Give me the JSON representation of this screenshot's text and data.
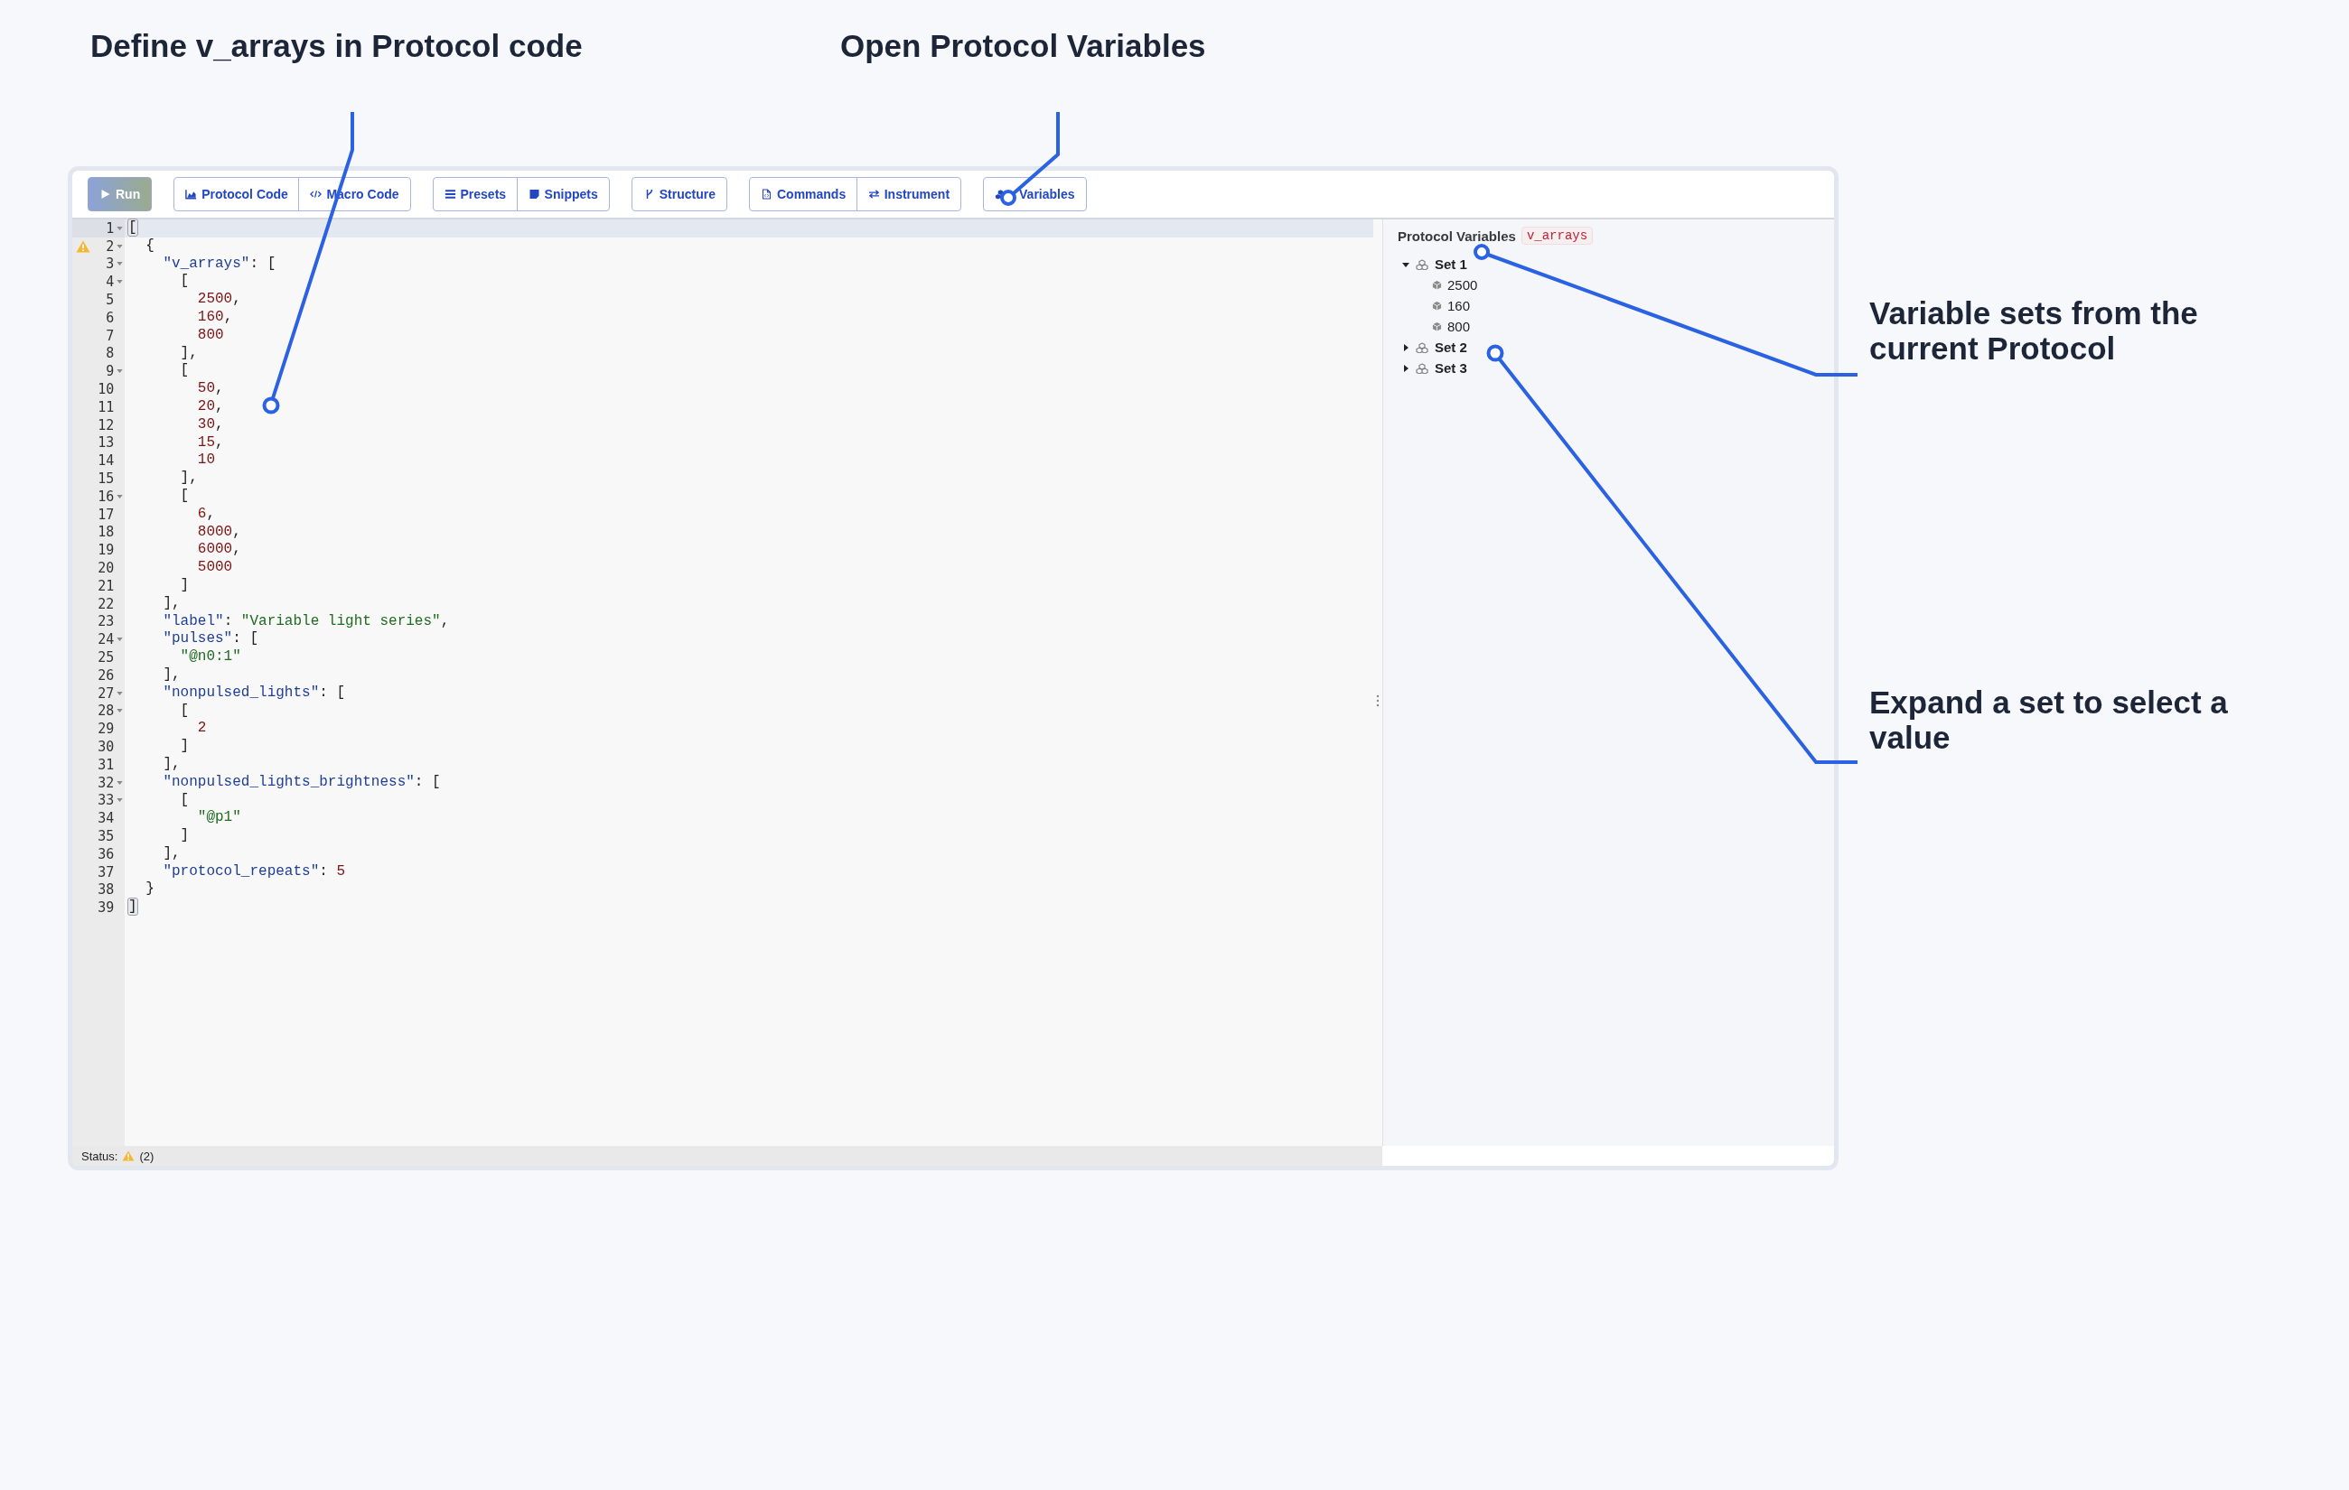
{
  "annotations": [
    {
      "text": "Define v_arrays in Protocol code"
    },
    {
      "text": "Open Protocol Variables"
    },
    {
      "text": "Variable sets from the current Protocol"
    },
    {
      "text": "Expand a set to select a value"
    }
  ],
  "toolbar": {
    "groups": [
      [
        {
          "label": "Run"
        }
      ],
      [
        {
          "label": "Protocol Code"
        },
        {
          "label": "Macro Code"
        }
      ],
      [
        {
          "label": "Presets"
        },
        {
          "label": "Snippets"
        }
      ],
      [
        {
          "label": "Structure"
        }
      ],
      [
        {
          "label": "Commands"
        },
        {
          "label": "Instrument"
        }
      ],
      [
        {
          "label": "Variables"
        }
      ]
    ]
  },
  "editor": {
    "lines": [
      {
        "number": "1",
        "fold": true,
        "warning": false,
        "active": true,
        "tokens": [
          {
            "kind": "bracket",
            "text": "["
          }
        ]
      },
      {
        "number": "2",
        "fold": true,
        "warning": true,
        "active": false,
        "tokens": [
          {
            "kind": "punct",
            "text": "  {"
          }
        ]
      },
      {
        "number": "3",
        "fold": true,
        "warning": false,
        "active": false,
        "tokens": [
          {
            "kind": "key",
            "text": "    \"v_arrays\""
          },
          {
            "kind": "punct",
            "text": ": ["
          }
        ]
      },
      {
        "number": "4",
        "fold": true,
        "warning": false,
        "active": false,
        "tokens": [
          {
            "kind": "punct",
            "text": "      ["
          }
        ]
      },
      {
        "number": "5",
        "fold": false,
        "warning": false,
        "active": false,
        "tokens": [
          {
            "kind": "number",
            "text": "        2500"
          },
          {
            "kind": "punct",
            "text": ","
          }
        ]
      },
      {
        "number": "6",
        "fold": false,
        "warning": false,
        "active": false,
        "tokens": [
          {
            "kind": "number",
            "text": "        160"
          },
          {
            "kind": "punct",
            "text": ","
          }
        ]
      },
      {
        "number": "7",
        "fold": false,
        "warning": false,
        "active": false,
        "tokens": [
          {
            "kind": "number",
            "text": "        800"
          }
        ]
      },
      {
        "number": "8",
        "fold": false,
        "warning": false,
        "active": false,
        "tokens": [
          {
            "kind": "punct",
            "text": "      ],"
          }
        ]
      },
      {
        "number": "9",
        "fold": true,
        "warning": false,
        "active": false,
        "tokens": [
          {
            "kind": "punct",
            "text": "      ["
          }
        ]
      },
      {
        "number": "10",
        "fold": false,
        "warning": false,
        "active": false,
        "tokens": [
          {
            "kind": "number",
            "text": "        50"
          },
          {
            "kind": "punct",
            "text": ","
          }
        ]
      },
      {
        "number": "11",
        "fold": false,
        "warning": false,
        "active": false,
        "tokens": [
          {
            "kind": "number",
            "text": "        20"
          },
          {
            "kind": "punct",
            "text": ","
          }
        ]
      },
      {
        "number": "12",
        "fold": false,
        "warning": false,
        "active": false,
        "tokens": [
          {
            "kind": "number",
            "text": "        30"
          },
          {
            "kind": "punct",
            "text": ","
          }
        ]
      },
      {
        "number": "13",
        "fold": false,
        "warning": false,
        "active": false,
        "tokens": [
          {
            "kind": "number",
            "text": "        15"
          },
          {
            "kind": "punct",
            "text": ","
          }
        ]
      },
      {
        "number": "14",
        "fold": false,
        "warning": false,
        "active": false,
        "tokens": [
          {
            "kind": "number",
            "text": "        10"
          }
        ]
      },
      {
        "number": "15",
        "fold": false,
        "warning": false,
        "active": false,
        "tokens": [
          {
            "kind": "punct",
            "text": "      ],"
          }
        ]
      },
      {
        "number": "16",
        "fold": true,
        "warning": false,
        "active": false,
        "tokens": [
          {
            "kind": "punct",
            "text": "      ["
          }
        ]
      },
      {
        "number": "17",
        "fold": false,
        "warning": false,
        "active": false,
        "tokens": [
          {
            "kind": "number",
            "text": "        6"
          },
          {
            "kind": "punct",
            "text": ","
          }
        ]
      },
      {
        "number": "18",
        "fold": false,
        "warning": false,
        "active": false,
        "tokens": [
          {
            "kind": "number",
            "text": "        8000"
          },
          {
            "kind": "punct",
            "text": ","
          }
        ]
      },
      {
        "number": "19",
        "fold": false,
        "warning": false,
        "active": false,
        "tokens": [
          {
            "kind": "number",
            "text": "        6000"
          },
          {
            "kind": "punct",
            "text": ","
          }
        ]
      },
      {
        "number": "20",
        "fold": false,
        "warning": false,
        "active": false,
        "tokens": [
          {
            "kind": "number",
            "text": "        5000"
          }
        ]
      },
      {
        "number": "21",
        "fold": false,
        "warning": false,
        "active": false,
        "tokens": [
          {
            "kind": "punct",
            "text": "      ]"
          }
        ]
      },
      {
        "number": "22",
        "fold": false,
        "warning": false,
        "active": false,
        "tokens": [
          {
            "kind": "punct",
            "text": "    ],"
          }
        ]
      },
      {
        "number": "23",
        "fold": false,
        "warning": false,
        "active": false,
        "tokens": [
          {
            "kind": "key",
            "text": "    \"label\""
          },
          {
            "kind": "punct",
            "text": ": "
          },
          {
            "kind": "string",
            "text": "\"Variable light series\""
          },
          {
            "kind": "punct",
            "text": ","
          }
        ]
      },
      {
        "number": "24",
        "fold": true,
        "warning": false,
        "active": false,
        "tokens": [
          {
            "kind": "key",
            "text": "    \"pulses\""
          },
          {
            "kind": "punct",
            "text": ": ["
          }
        ]
      },
      {
        "number": "25",
        "fold": false,
        "warning": false,
        "active": false,
        "tokens": [
          {
            "kind": "string",
            "text": "      \"@n0:1\""
          }
        ]
      },
      {
        "number": "26",
        "fold": false,
        "warning": false,
        "active": false,
        "tokens": [
          {
            "kind": "punct",
            "text": "    ],"
          }
        ]
      },
      {
        "number": "27",
        "fold": true,
        "warning": false,
        "active": false,
        "tokens": [
          {
            "kind": "key",
            "text": "    \"nonpulsed_lights\""
          },
          {
            "kind": "punct",
            "text": ": ["
          }
        ]
      },
      {
        "number": "28",
        "fold": true,
        "warning": false,
        "active": false,
        "tokens": [
          {
            "kind": "punct",
            "text": "      ["
          }
        ]
      },
      {
        "number": "29",
        "fold": false,
        "warning": false,
        "active": false,
        "tokens": [
          {
            "kind": "number",
            "text": "        2"
          }
        ]
      },
      {
        "number": "30",
        "fold": false,
        "warning": false,
        "active": false,
        "tokens": [
          {
            "kind": "punct",
            "text": "      ]"
          }
        ]
      },
      {
        "number": "31",
        "fold": false,
        "warning": false,
        "active": false,
        "tokens": [
          {
            "kind": "punct",
            "text": "    ],"
          }
        ]
      },
      {
        "number": "32",
        "fold": true,
        "warning": false,
        "active": false,
        "tokens": [
          {
            "kind": "key",
            "text": "    \"nonpulsed_lights_brightness\""
          },
          {
            "kind": "punct",
            "text": ": ["
          }
        ]
      },
      {
        "number": "33",
        "fold": true,
        "warning": false,
        "active": false,
        "tokens": [
          {
            "kind": "punct",
            "text": "      ["
          }
        ]
      },
      {
        "number": "34",
        "fold": false,
        "warning": false,
        "active": false,
        "tokens": [
          {
            "kind": "string",
            "text": "        \"@p1\""
          }
        ]
      },
      {
        "number": "35",
        "fold": false,
        "warning": false,
        "active": false,
        "tokens": [
          {
            "kind": "punct",
            "text": "      ]"
          }
        ]
      },
      {
        "number": "36",
        "fold": false,
        "warning": false,
        "active": false,
        "tokens": [
          {
            "kind": "punct",
            "text": "    ],"
          }
        ]
      },
      {
        "number": "37",
        "fold": false,
        "warning": false,
        "active": false,
        "tokens": [
          {
            "kind": "key",
            "text": "    \"protocol_repeats\""
          },
          {
            "kind": "punct",
            "text": ": "
          },
          {
            "kind": "number",
            "text": "5"
          }
        ]
      },
      {
        "number": "38",
        "fold": false,
        "warning": false,
        "active": false,
        "tokens": [
          {
            "kind": "punct",
            "text": "  }"
          }
        ]
      },
      {
        "number": "39",
        "fold": false,
        "warning": false,
        "active": false,
        "tokens": [
          {
            "kind": "bracket",
            "text": "]"
          }
        ]
      }
    ]
  },
  "variables_panel": {
    "title": "Protocol Variables",
    "badge": "v_arrays",
    "sets": [
      {
        "label": "Set 1",
        "expanded": true,
        "children": [
          {
            "label": "2500"
          },
          {
            "label": "160"
          },
          {
            "label": "800"
          }
        ]
      },
      {
        "label": "Set 2",
        "expanded": false
      },
      {
        "label": "Set 3",
        "expanded": false
      }
    ]
  },
  "status_bar": {
    "label": "Status:",
    "warnings": "(2)"
  }
}
